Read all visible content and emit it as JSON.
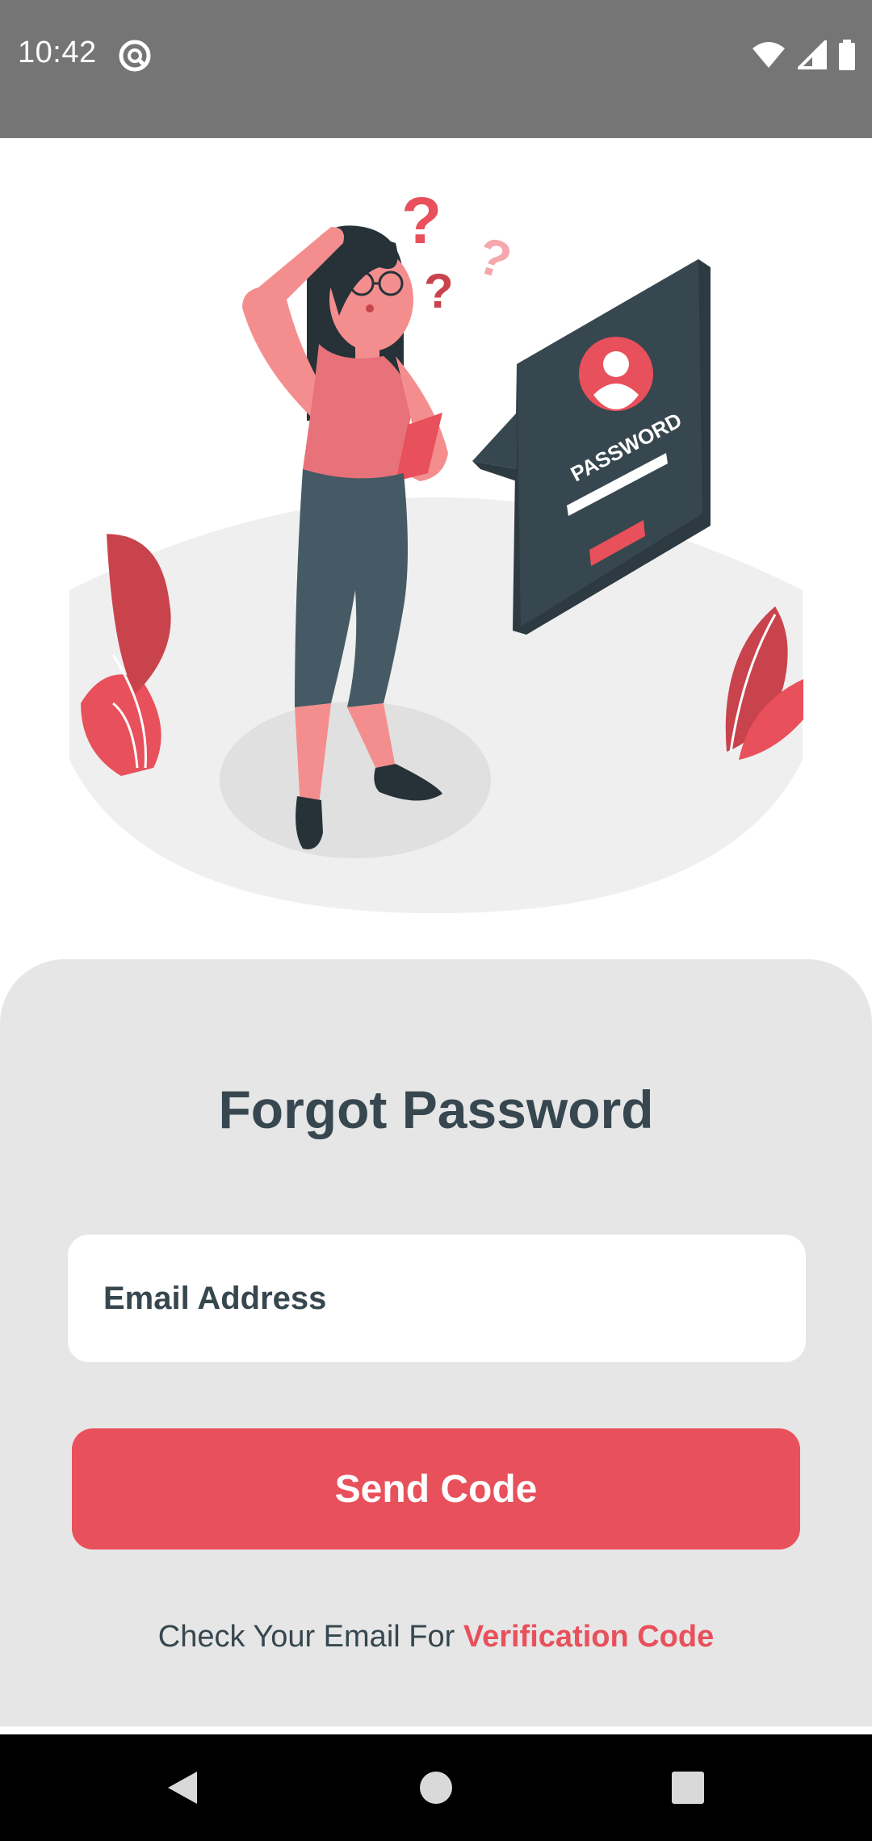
{
  "status_bar": {
    "time": "10:42",
    "background": "#757575"
  },
  "illustration": {
    "screen_label": "PASSWORD",
    "icon": "forgot-password-illustration"
  },
  "form": {
    "title": "Forgot Password",
    "email_placeholder": "Email Address",
    "send_button_label": "Send Code",
    "hint_prefix": "Check Your Email For ",
    "hint_link": "Verification Code"
  },
  "colors": {
    "accent": "#e8505b",
    "text_dark": "#37474f",
    "card_background": "#e6e6e6"
  },
  "nav_bar": {
    "icons": [
      "back-icon",
      "home-icon",
      "recents-icon"
    ]
  }
}
